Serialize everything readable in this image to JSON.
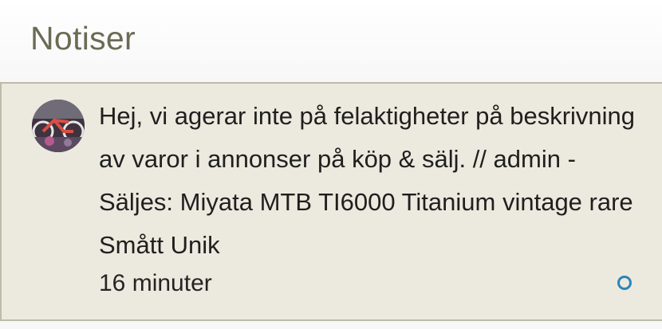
{
  "header": {
    "title": "Notiser"
  },
  "notification": {
    "avatar_icon": "user-avatar-bicycle-photo",
    "message": "Hej, vi agerar inte på felaktigheter på beskrivning av varor i annonser på köp & sälj. // admin - Säljes: Miyata MTB TI6000 Titanium vintage rare Smått Unik",
    "time": "16 minuter",
    "status_icon": "unread-circle-icon"
  },
  "colors": {
    "title": "#6b6b55",
    "notice_background": "#ece9de",
    "accent": "#2a86b8"
  }
}
